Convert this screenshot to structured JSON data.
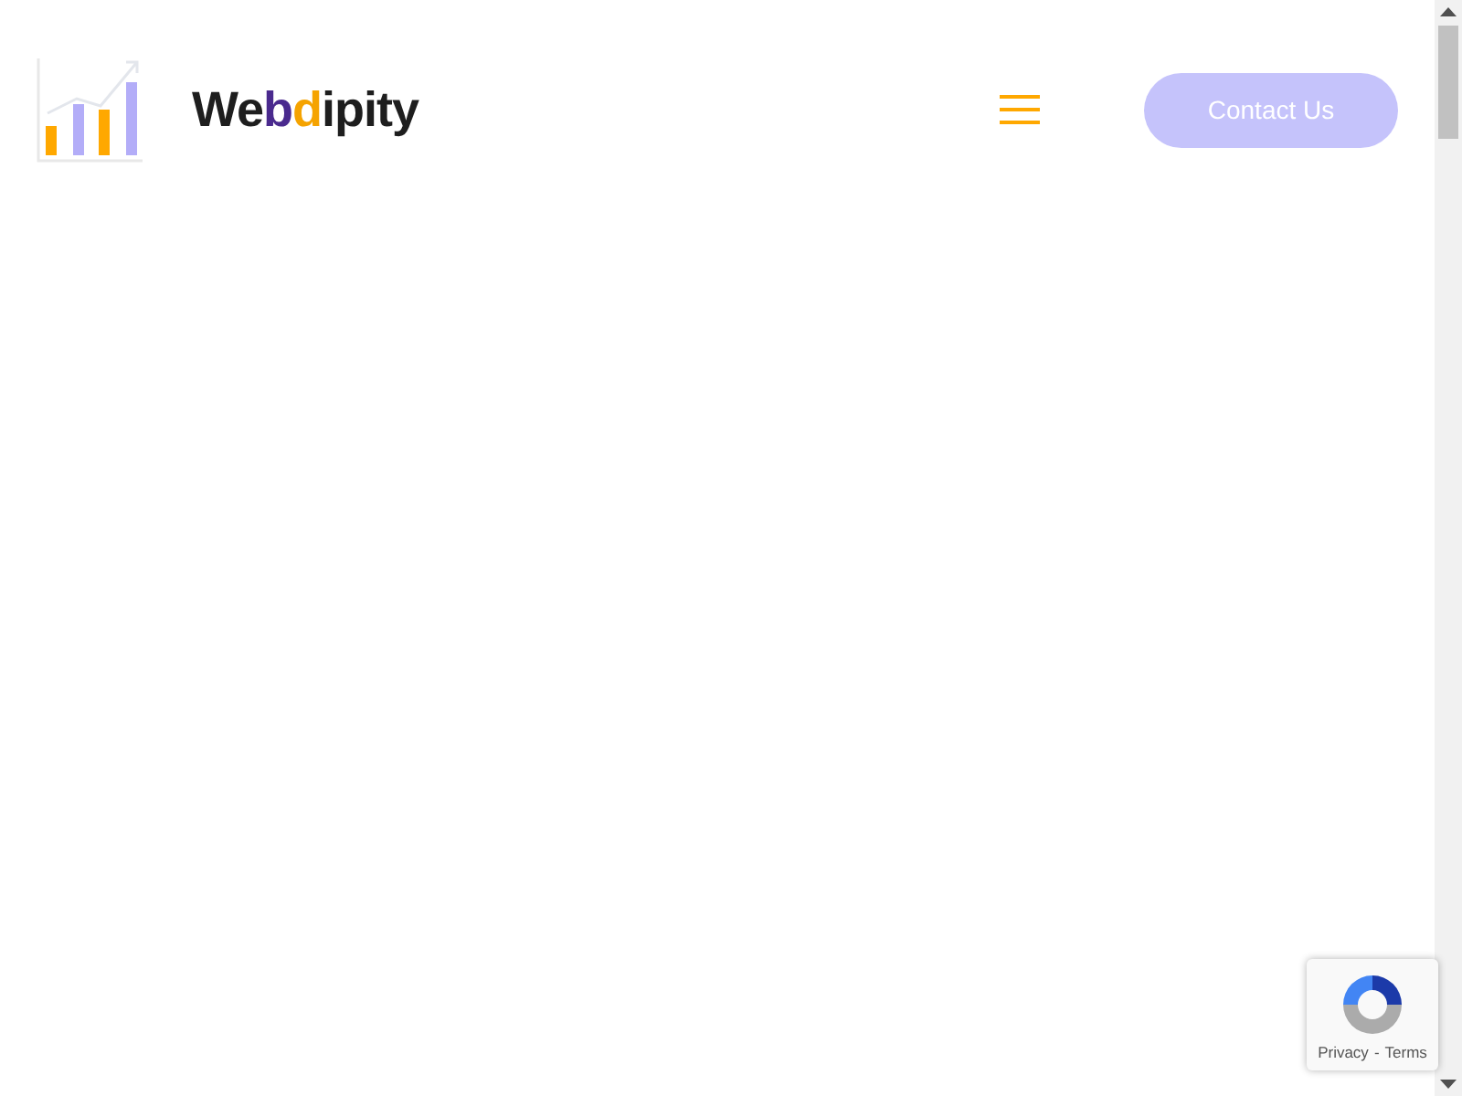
{
  "header": {
    "brand": [
      {
        "text": "We",
        "color": "#1e1e1e"
      },
      {
        "text": "b",
        "color": "#4a2a8e"
      },
      {
        "text": "d",
        "color": "#f5a300"
      },
      {
        "text": "ipity",
        "color": "#1e1e1e"
      }
    ],
    "contact_button": "Contact Us"
  },
  "recaptcha": {
    "links": [
      "Privacy",
      "Terms"
    ],
    "separator": "-"
  }
}
